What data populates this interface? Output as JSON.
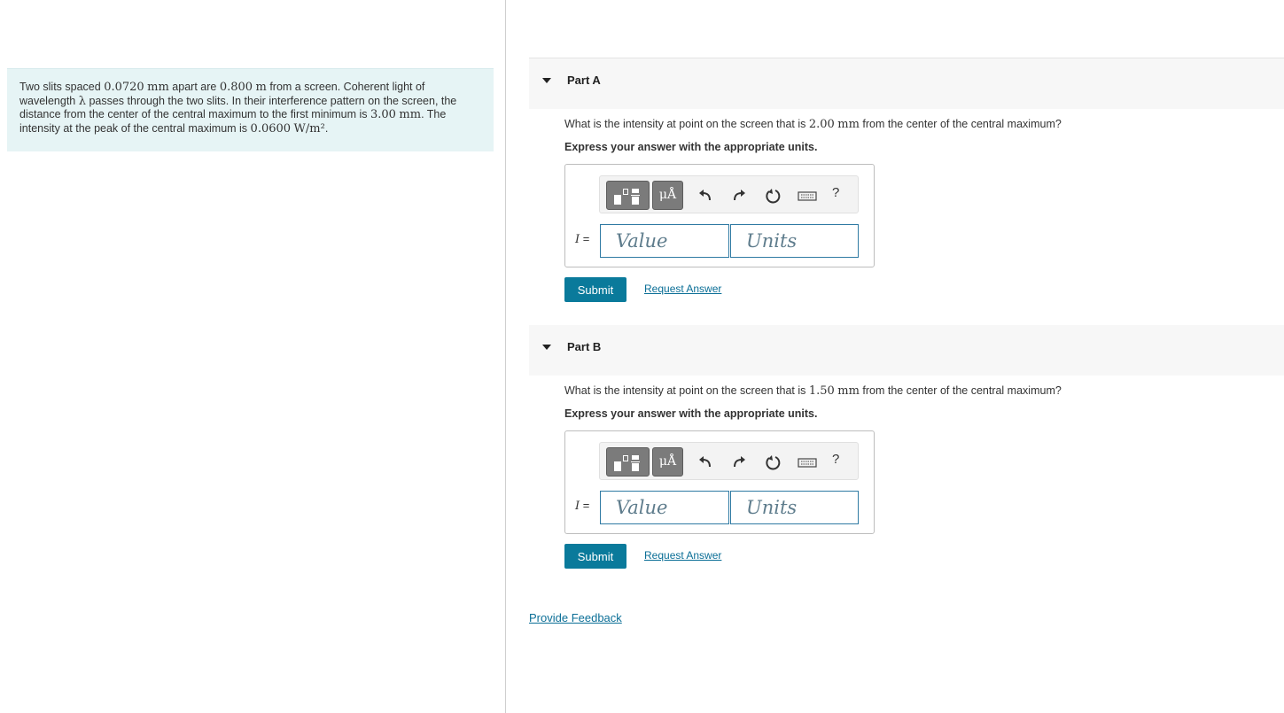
{
  "problem": {
    "line1_prefix": "Two slits spaced ",
    "spacing": "0.0720",
    "spacing_unit": "mm",
    "line1_mid": " apart are ",
    "distance": "0.800",
    "distance_unit": "m",
    "line1_suffix": " from a screen. Coherent light of",
    "line2_prefix": "wavelength ",
    "lambda": "λ",
    "line2_suffix": " passes through the two slits. In their interference pattern on the screen, the",
    "line3_prefix": "distance from the center of the central maximum to the first minimum is ",
    "min_distance": "3.00",
    "min_distance_unit": "mm",
    "line3_suffix": ". The",
    "line4_prefix": "intensity at the peak of the central maximum is ",
    "peak": "0.0600",
    "peak_unit": "W/m²",
    "line4_suffix": "."
  },
  "parts": [
    {
      "title": "Part A",
      "question_prefix": "What is the intensity at point on the screen that is ",
      "question_value": "2.00",
      "question_unit": "mm",
      "question_suffix": " from the center of the central maximum?",
      "instruction": "Express your answer with the appropriate units.",
      "unit_button": "μÅ",
      "help": "?",
      "variable": "I",
      "equals": " =",
      "value_placeholder": "Value",
      "units_placeholder": "Units",
      "submit": "Submit",
      "request": "Request Answer"
    },
    {
      "title": "Part B",
      "question_prefix": "What is the intensity at point on the screen that is ",
      "question_value": "1.50",
      "question_unit": "mm",
      "question_suffix": " from the center of the central maximum?",
      "instruction": "Express your answer with the appropriate units.",
      "unit_button": "μÅ",
      "help": "?",
      "variable": "I",
      "equals": " =",
      "value_placeholder": "Value",
      "units_placeholder": "Units",
      "submit": "Submit",
      "request": "Request Answer"
    }
  ],
  "feedback": "Provide Feedback",
  "icons": [
    "templates-icon",
    "units-icon",
    "undo-icon",
    "redo-icon",
    "reset-icon",
    "keyboard-icon",
    "help-icon"
  ]
}
